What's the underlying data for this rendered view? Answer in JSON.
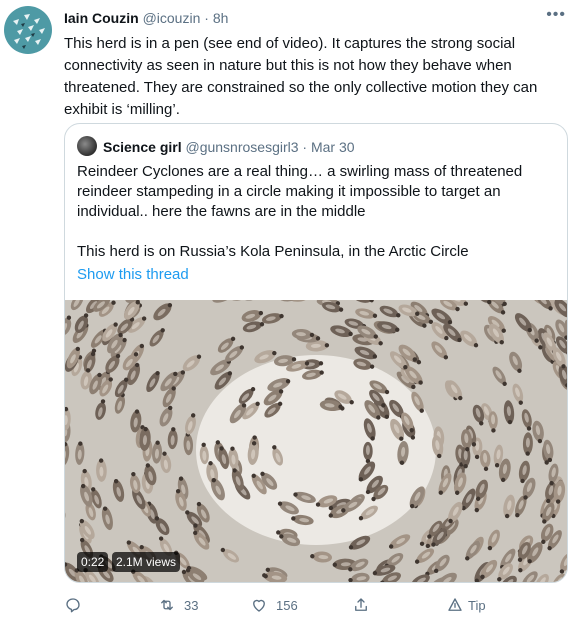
{
  "author": {
    "name": "Iain Couzin",
    "handle": "@icouzin",
    "separator": "·",
    "time": "8h"
  },
  "more_icon": "more-horizontal-icon",
  "tweet_text": "This herd is in a pen (see end of video). It captures the strong social connectivity as seen in nature but this is not how they behave when threatened. They are constrained so the only collective motion they can exhibit is ‘milling’.",
  "quoted": {
    "name": "Science girl",
    "handle": "@gunsnrosesgirl3",
    "separator": "·",
    "date": "Mar 30",
    "text_1": "Reindeer Cyclones are a real thing… a swirling mass of  threatened reindeer stampeding in a circle making it impossible to target an individual..  here the fawns are in the middle",
    "text_2": "This herd is on Russia’s Kola Peninsula, in the Arctic Circle",
    "show_thread": "Show this thread",
    "video": {
      "duration": "0:22",
      "views": "2.1M views"
    }
  },
  "actions": {
    "reply": {
      "icon": "reply-icon",
      "count": ""
    },
    "retweet": {
      "icon": "retweet-icon",
      "count": "33"
    },
    "like": {
      "icon": "heart-icon",
      "count": "156"
    },
    "share": {
      "icon": "share-icon",
      "count": ""
    },
    "tip": {
      "icon": "tip-icon",
      "label": "Tip"
    }
  },
  "colors": {
    "link": "#1d9bf0",
    "muted": "#5b7083",
    "border": "#cfd9de",
    "avatar_bg": "#4e9aa5"
  }
}
